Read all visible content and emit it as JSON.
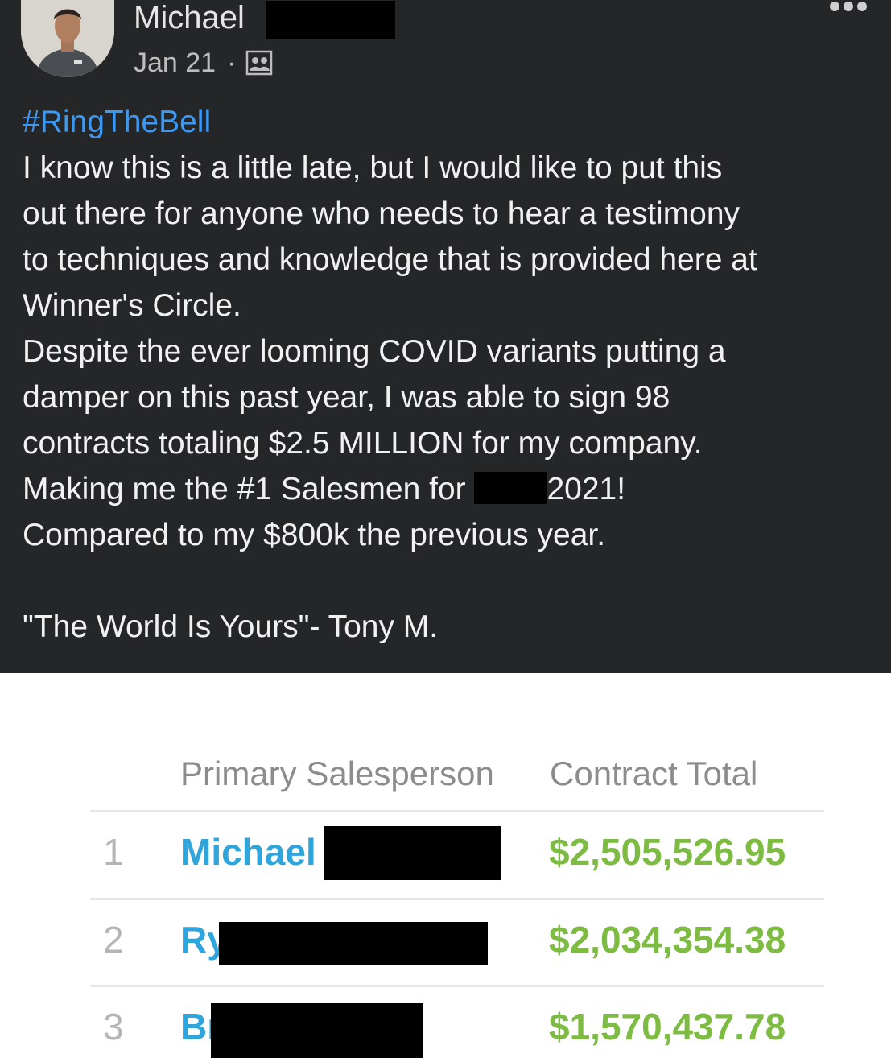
{
  "post": {
    "author_name": "Michael",
    "date": "Jan 21",
    "separator": "·",
    "audience_icon": "group-icon",
    "more_icon": "more-options-icon",
    "hashtag": "#RingTheBell",
    "lines": [
      "I know this is a little late, but I would like to put this",
      "out there for anyone who needs to hear a testimony",
      "to techniques and knowledge that is provided here at",
      "Winner's Circle.",
      "Despite the ever looming COVID variants putting a",
      "damper on this past year, I was able to sign 98",
      "contracts totaling $2.5 MILLION for my company."
    ],
    "line_salesman_before": "Making me the #1 Salesmen for",
    "line_salesman_after": "2021!",
    "line_compare": "Compared to my $800k the previous year.",
    "quote": "\"The World Is Yours\"- Tony M."
  },
  "table": {
    "col_salesperson": "Primary Salesperson",
    "col_total": "Contract Total",
    "rows": [
      {
        "rank": "1",
        "name": "Michael",
        "total": "$2,505,526.95"
      },
      {
        "rank": "2",
        "name": "Ry",
        "total": "$2,034,354.38"
      },
      {
        "rank": "3",
        "name": "Br",
        "total": "$1,570,437.78"
      }
    ]
  },
  "colors": {
    "post_background": "#252628",
    "hashtag": "#3b99f5",
    "name_link": "#2fa5dc",
    "amount": "#7dbb42",
    "redaction": "#000000"
  }
}
